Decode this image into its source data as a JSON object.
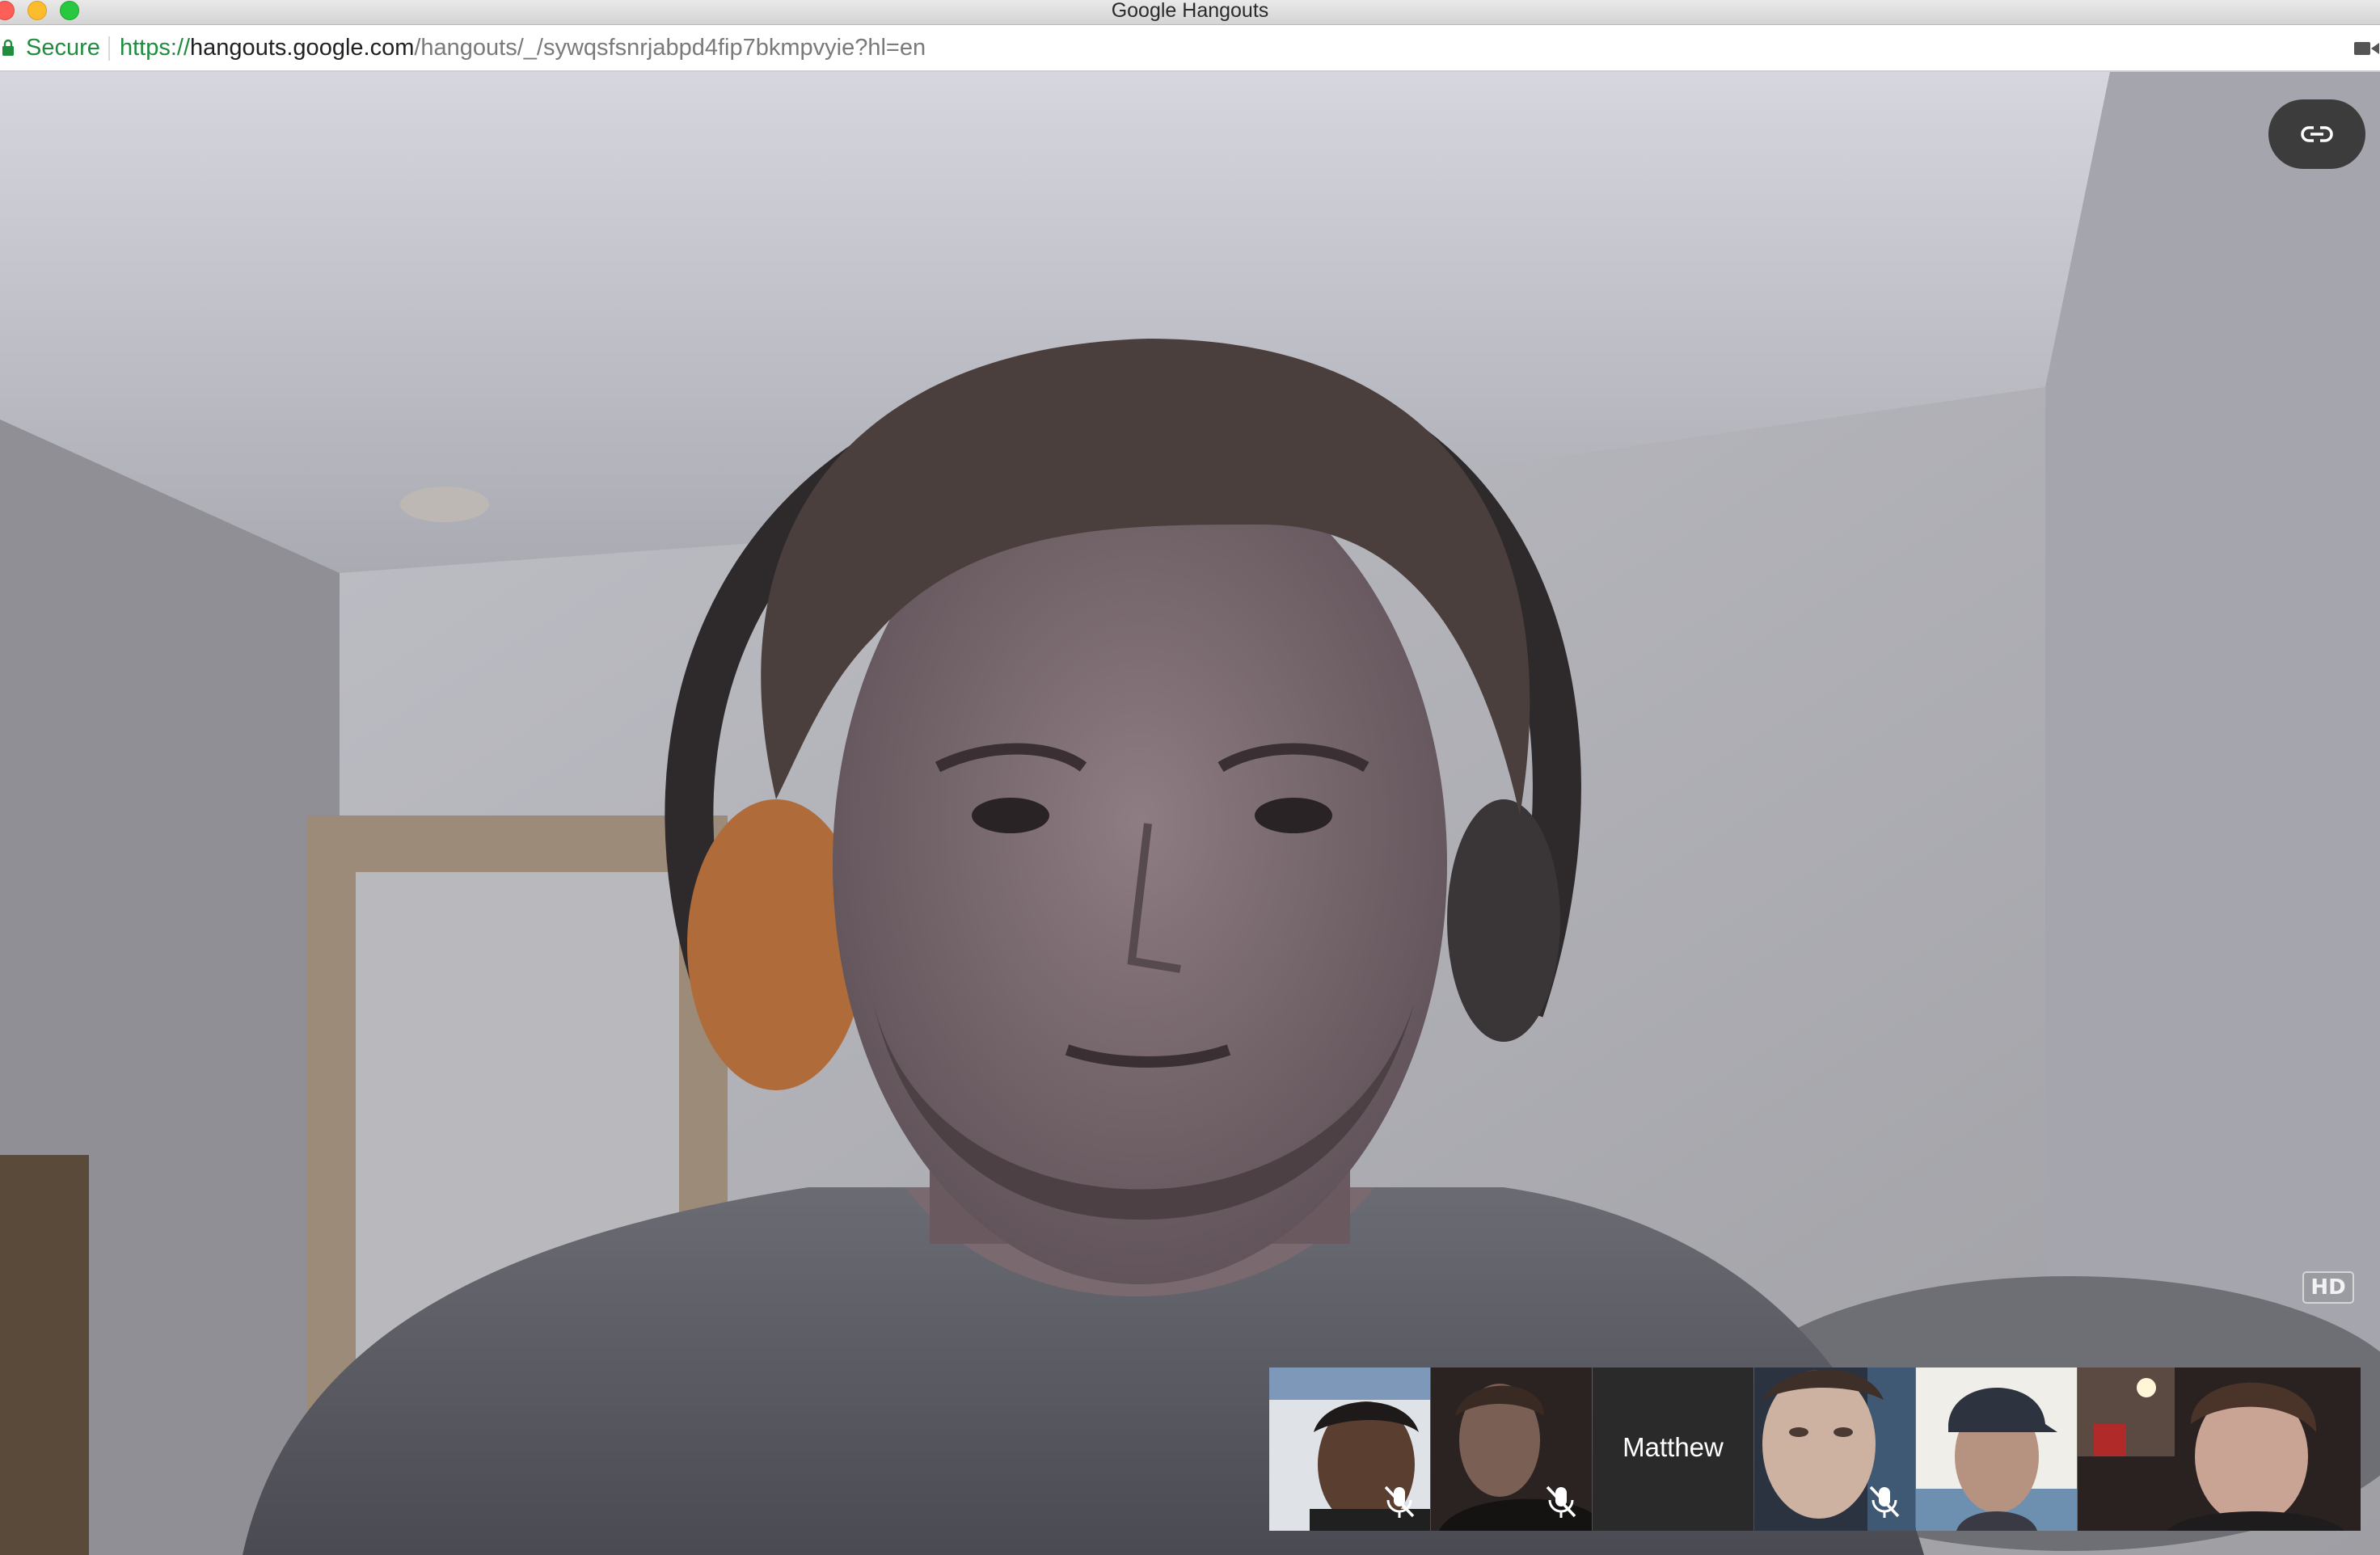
{
  "window": {
    "title": "Google Hangouts"
  },
  "address_bar": {
    "secure_label": "Secure",
    "url_scheme": "https://",
    "url_host": "hangouts.google.com",
    "url_path": "/hangouts/_/sywqsfsnrjabpd4fip7bkmpvyie?hl=en",
    "icons": [
      "lock-icon",
      "camera-icon"
    ]
  },
  "call": {
    "link_button_icon": "link-icon",
    "quality_badge": "HD",
    "participants": [
      {
        "name": "",
        "muted": true
      },
      {
        "name": "",
        "muted": true
      },
      {
        "name": "Matthew",
        "muted": false
      },
      {
        "name": "",
        "muted": true
      },
      {
        "name": "",
        "muted": false
      },
      {
        "name": "",
        "muted": false
      }
    ]
  },
  "colors": {
    "secure_green": "#1e8e3e",
    "control_bg": "#3c3c3c"
  }
}
